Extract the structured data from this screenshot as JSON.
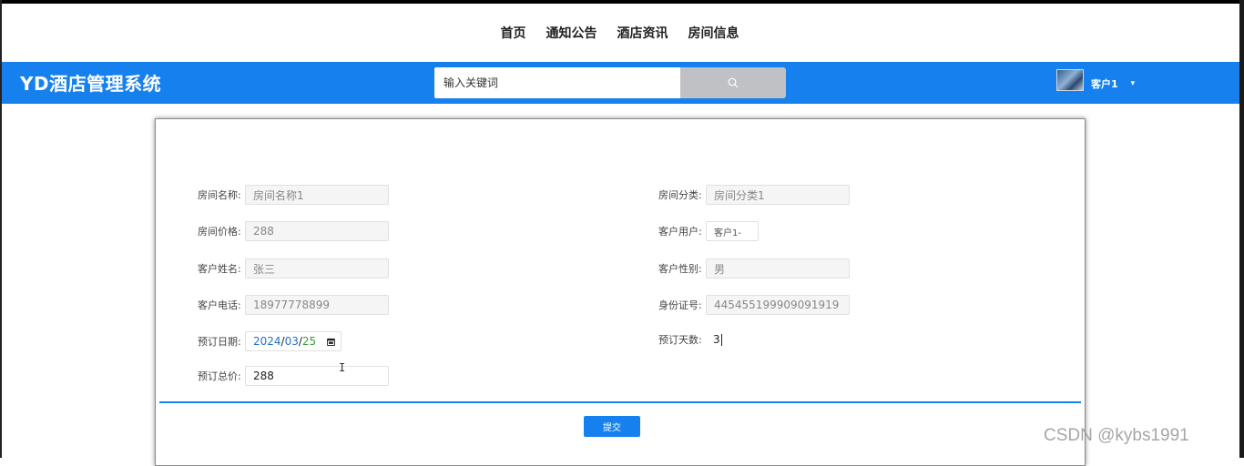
{
  "topnav": {
    "items": [
      "首页",
      "通知公告",
      "酒店资讯",
      "房间信息"
    ]
  },
  "header": {
    "brand": "YD酒店管理系统",
    "search_placeholder": "输入关键词",
    "search_icon": "search-icon",
    "user_name": "客户1",
    "user_caret_icon": "caret-down-icon",
    "color": "#1681ee"
  },
  "form": {
    "room_name": {
      "label": "房间名称:",
      "value": "房间名称1"
    },
    "room_category": {
      "label": "房间分类:",
      "value": "房间分类1"
    },
    "room_price": {
      "label": "房间价格:",
      "value": "288"
    },
    "customer_user": {
      "label": "客户用户:",
      "value": "客户1-"
    },
    "customer_name": {
      "label": "客户姓名:",
      "value": "张三"
    },
    "customer_gender": {
      "label": "客户性别:",
      "value": "男"
    },
    "customer_phone": {
      "label": "客户电话:",
      "value": "18977778899"
    },
    "id_number": {
      "label": "身份证号:",
      "value": "445455199909091919"
    },
    "booking_date": {
      "label": "预订日期:",
      "year": "2024",
      "month": "03",
      "day": "25",
      "sep": "/"
    },
    "booking_days": {
      "label": "预订天数:",
      "value": "3"
    },
    "total_price": {
      "label": "预订总价:",
      "value": "288"
    },
    "submit_label": "提交"
  },
  "watermark": "CSDN @kybs1991"
}
